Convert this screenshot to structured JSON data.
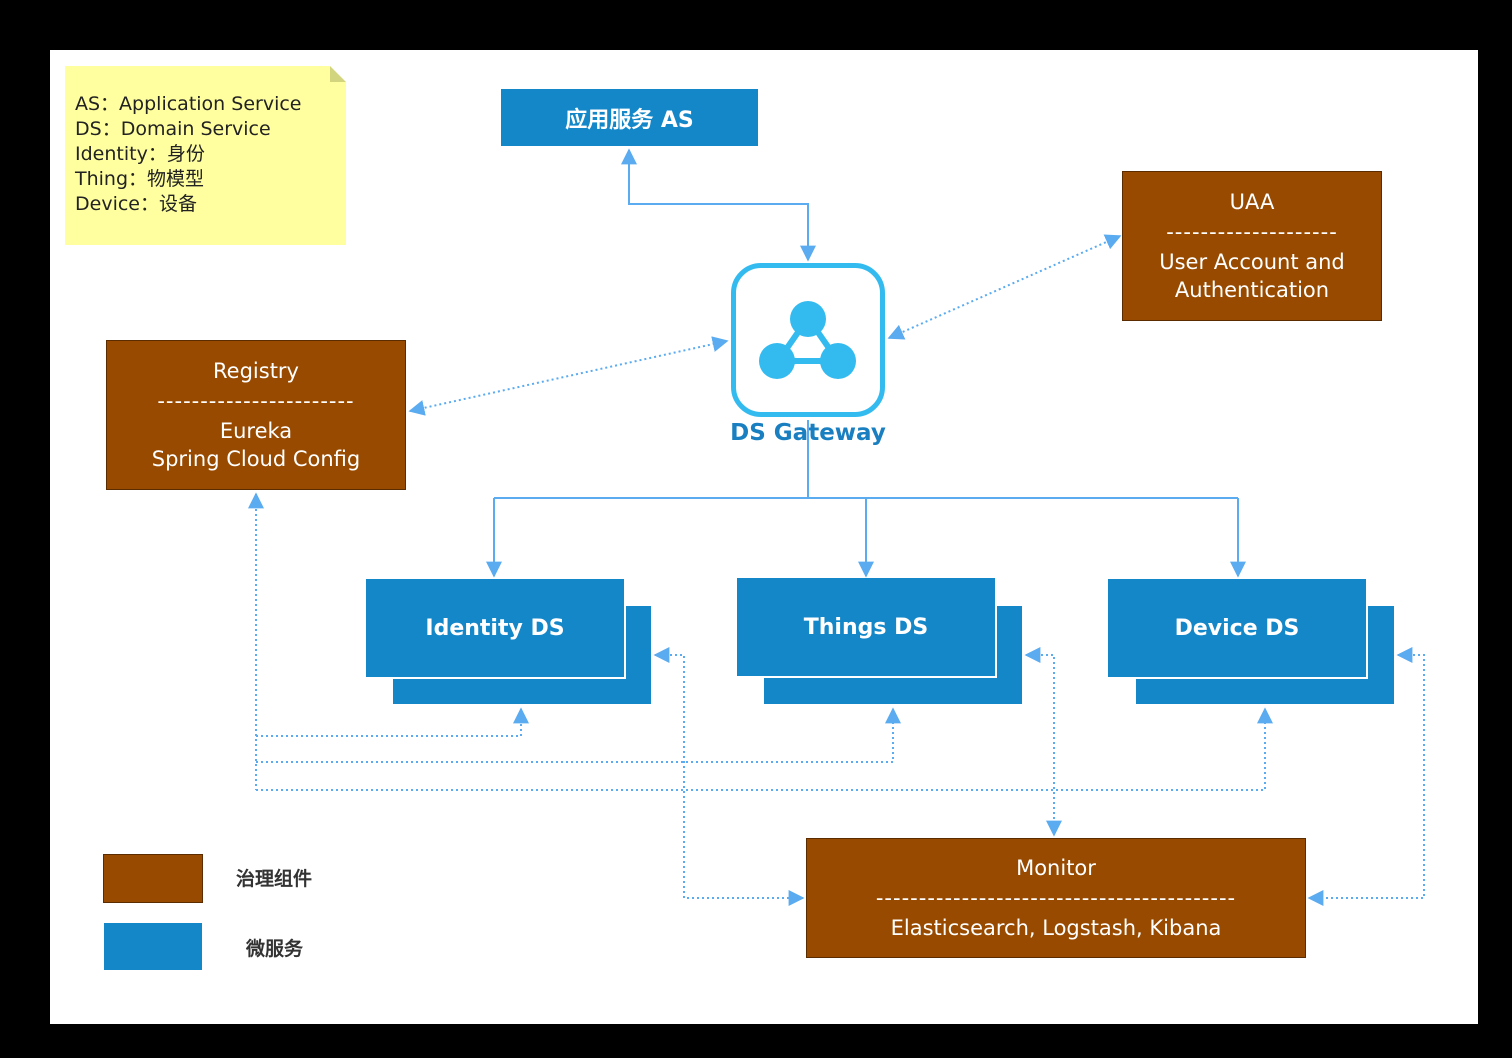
{
  "legend_note": {
    "lines": [
      "AS：Application Service",
      "DS：Domain Service",
      "Identity：身份",
      "Thing：物模型",
      "Device：设备"
    ]
  },
  "as_box": {
    "label": "应用服务 AS"
  },
  "gateway": {
    "label": "DS Gateway",
    "icon": "share-nodes-icon"
  },
  "uaa": {
    "title": "UAA",
    "divider": "--------------------",
    "subtitle": "User Account and Authentication"
  },
  "registry": {
    "title": "Registry",
    "divider": "-----------------------",
    "lines": [
      "Eureka",
      "Spring Cloud Config"
    ]
  },
  "services": [
    {
      "label": "Identity DS"
    },
    {
      "label": "Things DS"
    },
    {
      "label": "Device DS"
    }
  ],
  "monitor": {
    "title": "Monitor",
    "divider": "------------------------------------------",
    "subtitle": "Elasticsearch, Logstash, Kibana"
  },
  "legend": {
    "governance": "治理组件",
    "microservice": "微服务"
  },
  "colors": {
    "governance": "#974a00",
    "microservice": "#1487c8",
    "line": "#5aabf0",
    "gateway": "#33bbf0"
  }
}
